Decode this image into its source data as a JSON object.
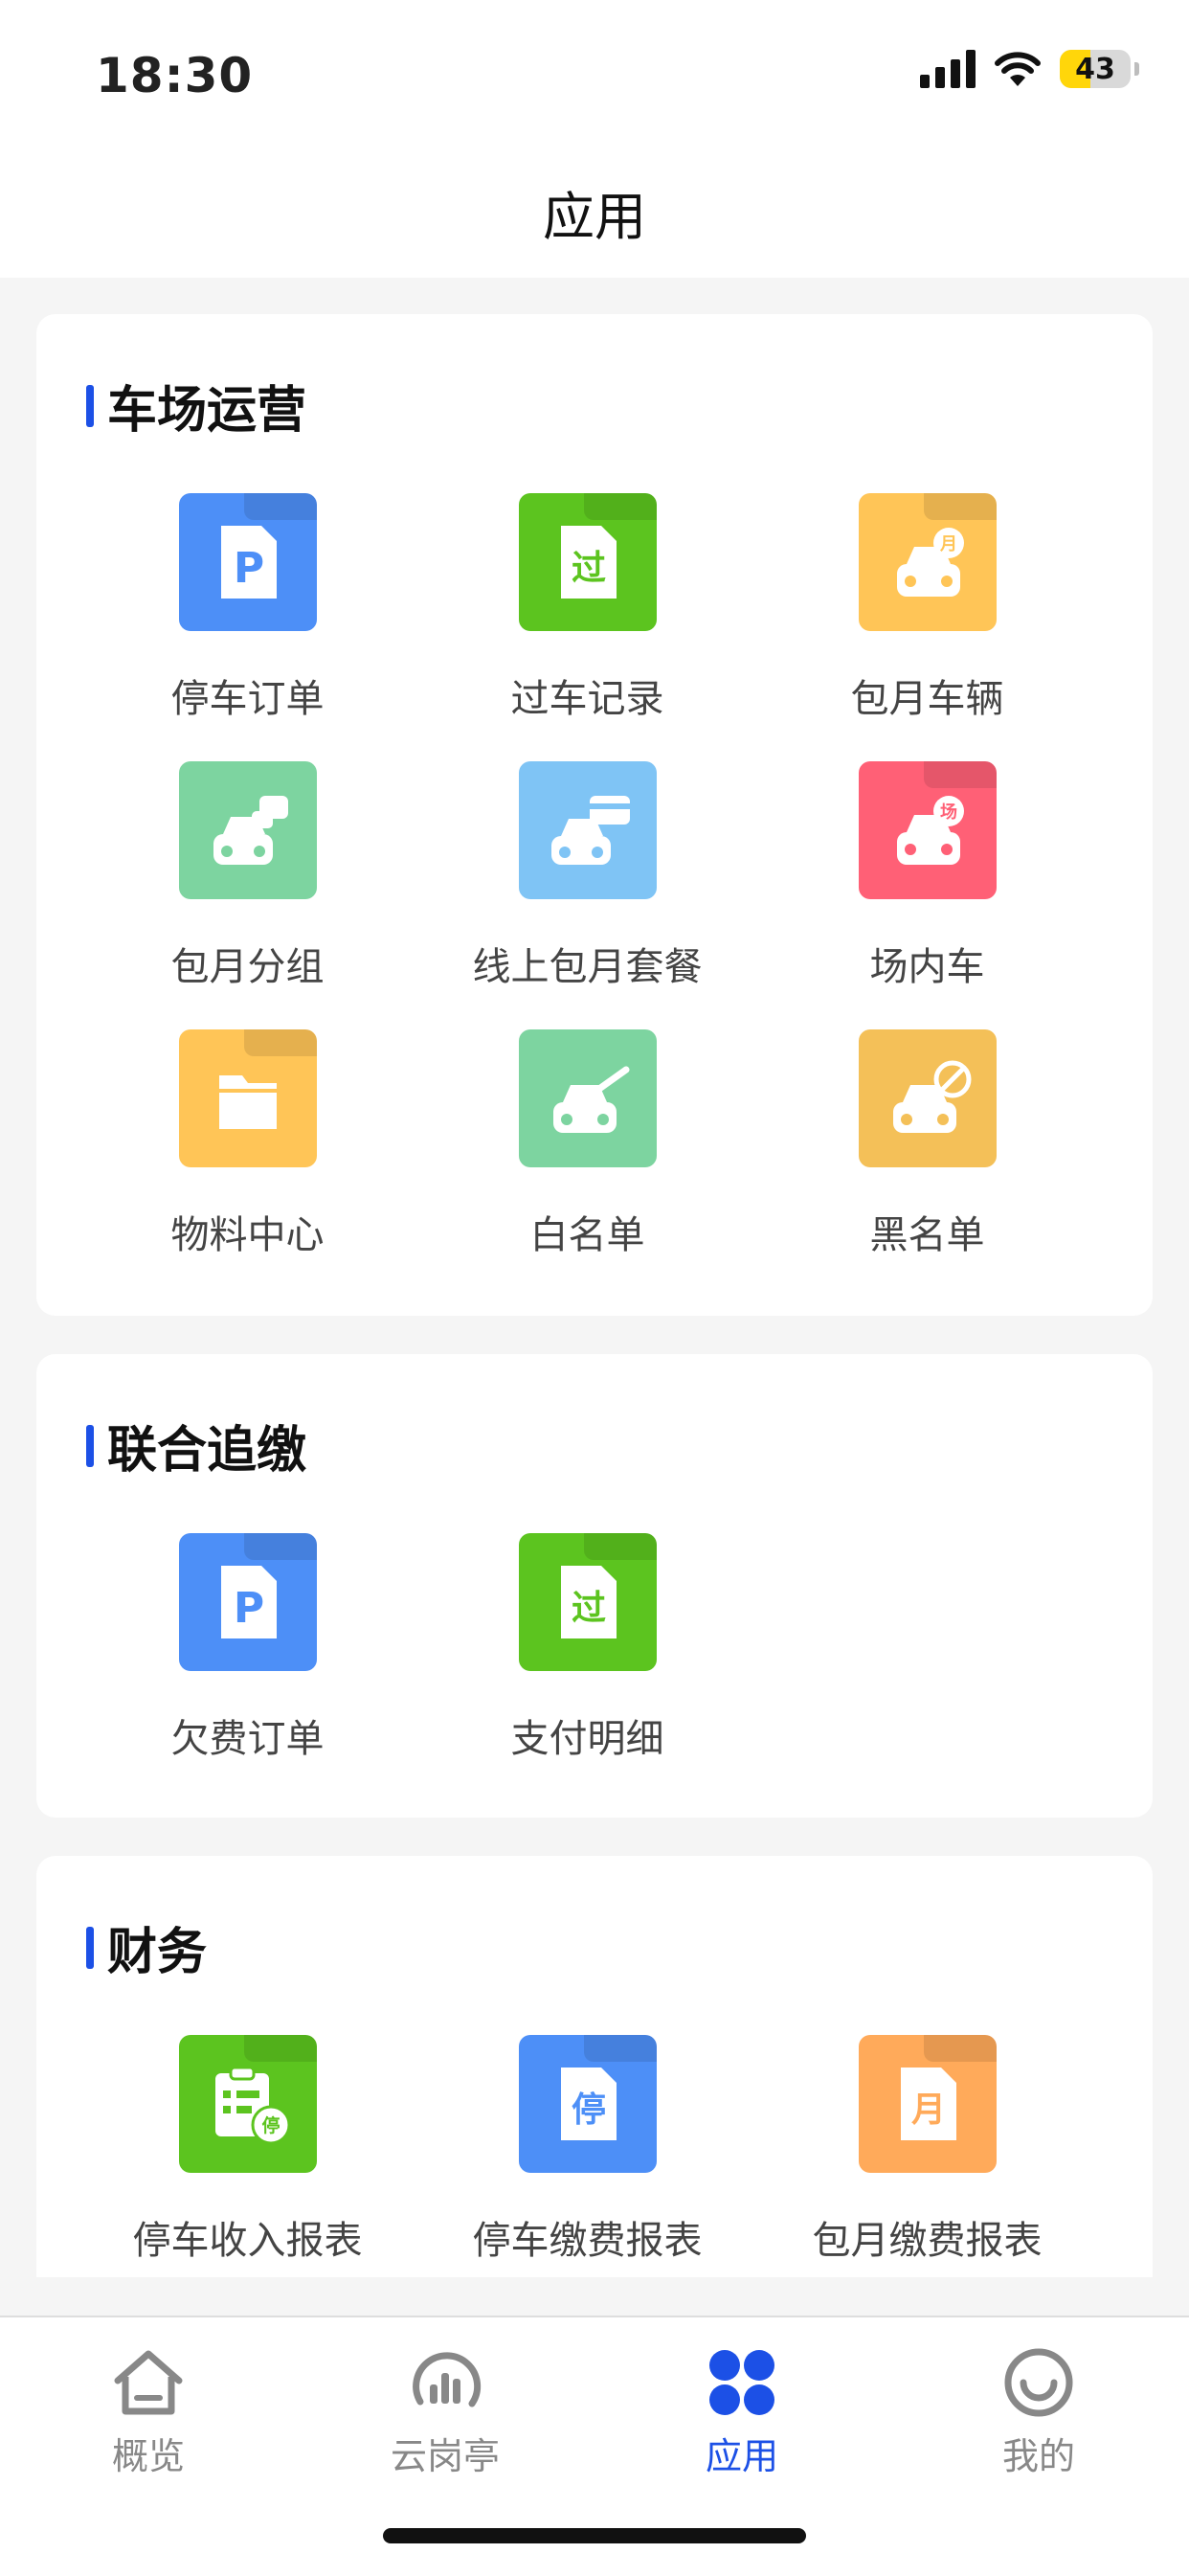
{
  "status": {
    "time": "18:30",
    "battery": "43"
  },
  "header": {
    "title": "应用"
  },
  "sections": [
    {
      "title": "车场运营",
      "items": [
        {
          "label": "停车订单",
          "icon": "parking-p-icon",
          "color": "#4d8ff7"
        },
        {
          "label": "过车记录",
          "icon": "pass-doc-icon",
          "color": "#5cc41f"
        },
        {
          "label": "包月车辆",
          "icon": "monthly-car-icon",
          "color": "#ffc557"
        },
        {
          "label": "包月分组",
          "icon": "car-group-icon",
          "color": "#7dd4a0"
        },
        {
          "label": "线上包月套餐",
          "icon": "car-card-icon",
          "color": "#7fc4f5"
        },
        {
          "label": "场内车",
          "icon": "onsite-car-icon",
          "color": "#ff6076"
        },
        {
          "label": "物料中心",
          "icon": "folder-icon",
          "color": "#ffc557"
        },
        {
          "label": "白名单",
          "icon": "car-check-icon",
          "color": "#7dd4a0"
        },
        {
          "label": "黑名单",
          "icon": "car-ban-icon",
          "color": "#f4c058"
        }
      ]
    },
    {
      "title": "联合追缴",
      "items": [
        {
          "label": "欠费订单",
          "icon": "parking-p-icon",
          "color": "#4d8ff7"
        },
        {
          "label": "支付明细",
          "icon": "pass-doc-icon",
          "color": "#5cc41f"
        }
      ]
    },
    {
      "title": "财务",
      "items": [
        {
          "label": "停车收入报表",
          "icon": "income-report-icon",
          "color": "#5cc41f"
        },
        {
          "label": "停车缴费报表",
          "icon": "parking-fee-doc-icon",
          "color": "#4d8ff7"
        },
        {
          "label": "包月缴费报表",
          "icon": "monthly-fee-doc-icon",
          "color": "#ffaa5a"
        }
      ]
    }
  ],
  "tabs": [
    {
      "label": "概览",
      "icon": "home-icon",
      "active": false
    },
    {
      "label": "云岗亭",
      "icon": "cloud-booth-icon",
      "active": false
    },
    {
      "label": "应用",
      "icon": "apps-icon",
      "active": true
    },
    {
      "label": "我的",
      "icon": "profile-smile-icon",
      "active": false
    }
  ],
  "glyphs": {
    "parking": "P",
    "pass": "过",
    "month": "月",
    "onsite": "场",
    "stop": "停"
  },
  "colors": {
    "accent": "#1c50e6"
  }
}
